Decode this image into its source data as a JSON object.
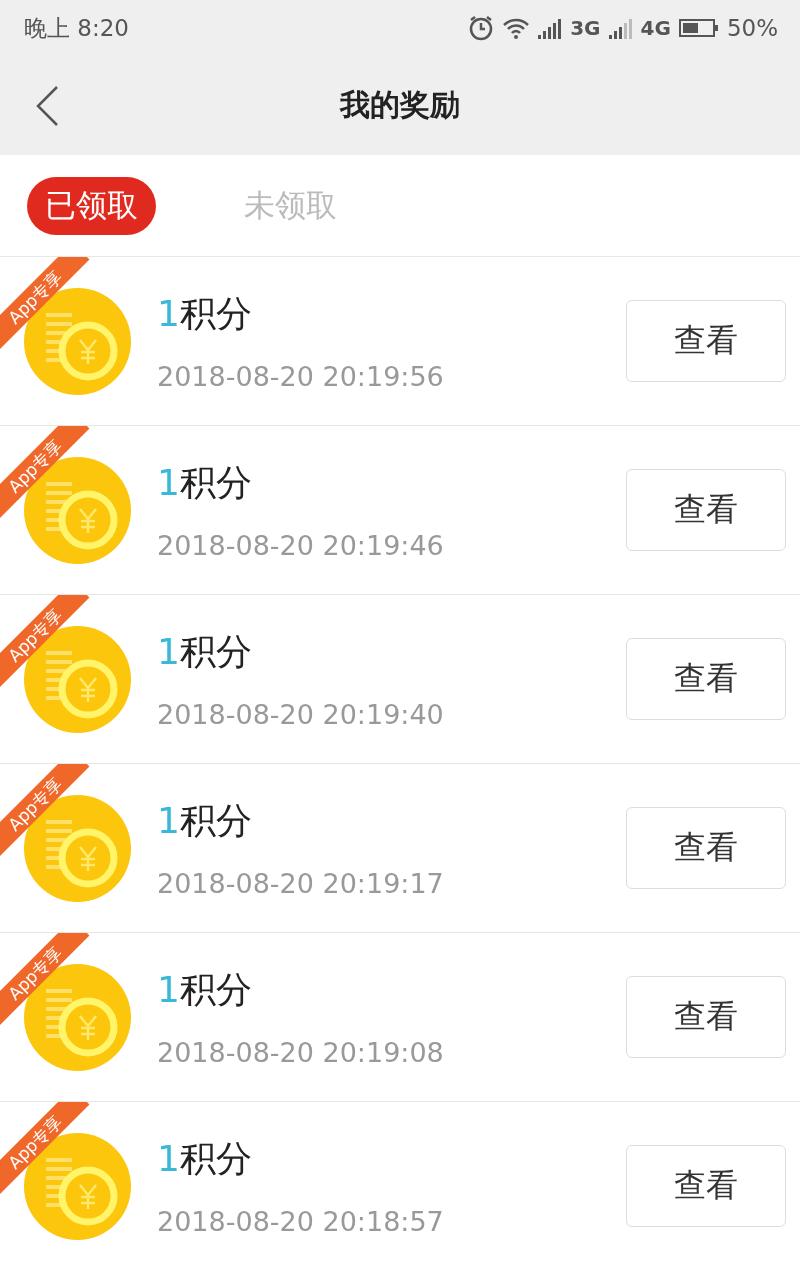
{
  "status_bar": {
    "time": "晚上 8:20",
    "network_1": "3G",
    "network_2": "4G",
    "battery": "50%"
  },
  "nav": {
    "title": "我的奖励"
  },
  "tabs": [
    {
      "label": "已领取",
      "selected": true
    },
    {
      "label": "未领取",
      "selected": false
    }
  ],
  "rewards": [
    {
      "ribbon": "App专享",
      "amount": "1",
      "unit": "积分",
      "time": "2018-08-20 20:19:56",
      "button": "查看"
    },
    {
      "ribbon": "App专享",
      "amount": "1",
      "unit": "积分",
      "time": "2018-08-20 20:19:46",
      "button": "查看"
    },
    {
      "ribbon": "App专享",
      "amount": "1",
      "unit": "积分",
      "time": "2018-08-20 20:19:40",
      "button": "查看"
    },
    {
      "ribbon": "App专享",
      "amount": "1",
      "unit": "积分",
      "time": "2018-08-20 20:19:17",
      "button": "查看"
    },
    {
      "ribbon": "App专享",
      "amount": "1",
      "unit": "积分",
      "time": "2018-08-20 20:19:08",
      "button": "查看"
    },
    {
      "ribbon": "App专享",
      "amount": "1",
      "unit": "积分",
      "time": "2018-08-20 20:18:57",
      "button": "查看"
    }
  ]
}
